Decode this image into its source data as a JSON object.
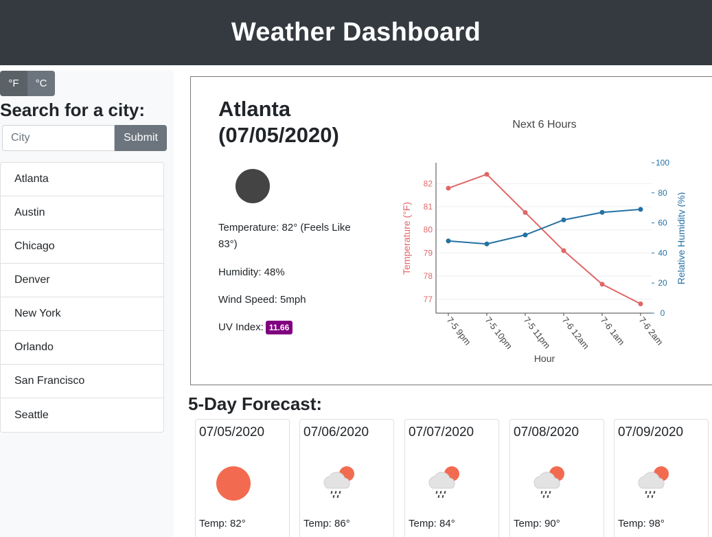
{
  "header": {
    "title": "Weather Dashboard"
  },
  "sidebar": {
    "unit_f": "°F",
    "unit_c": "°C",
    "search_title": "Search for a city:",
    "search_placeholder": "City",
    "submit_label": "Submit",
    "cities": [
      "Atlanta",
      "Austin",
      "Chicago",
      "Denver",
      "New York",
      "Orlando",
      "San Francisco",
      "Seattle"
    ]
  },
  "current": {
    "city": "Atlanta",
    "date": "(07/05/2020)",
    "icon": "moon-icon",
    "temperature_text": "Temperature:  82° (Feels Like 83°)",
    "humidity_text": "Humidity:  48%",
    "wind_text": "Wind Speed:  5mph",
    "uv_label": "UV Index:",
    "uv_value": "11.66",
    "uv_color": "#800080"
  },
  "chart_data": {
    "type": "line",
    "title": "Next 6 Hours",
    "xlabel": "Hour",
    "ylabel": "Temperature (°F)",
    "y2label": "Relative Humidity (%)",
    "categories": [
      "7-5 9pm",
      "7-5 10pm",
      "7-5 11pm",
      "7-6 12am",
      "7-6 1am",
      "7-6 2am"
    ],
    "y_ticks": [
      77,
      78,
      79,
      80,
      81,
      82
    ],
    "y2_ticks": [
      0,
      20,
      40,
      60,
      80,
      100
    ],
    "ylim": [
      76.4,
      82.9
    ],
    "y2lim": [
      0,
      100
    ],
    "series": [
      {
        "axis": "y",
        "color": "#e06666",
        "values": [
          81.8,
          82.4,
          80.75,
          79.1,
          77.65,
          76.8
        ]
      },
      {
        "axis": "y2",
        "color": "#2471a3",
        "values": [
          48,
          46,
          52,
          62,
          67,
          69
        ]
      }
    ]
  },
  "forecast": {
    "title": "5-Day Forecast:",
    "days": [
      {
        "date": "07/05/2020",
        "icon": "sun-icon",
        "temp": "Temp: 82°"
      },
      {
        "date": "07/06/2020",
        "icon": "rain-cloud-icon",
        "temp": "Temp: 86°"
      },
      {
        "date": "07/07/2020",
        "icon": "rain-cloud-icon",
        "temp": "Temp: 84°"
      },
      {
        "date": "07/08/2020",
        "icon": "rain-cloud-icon",
        "temp": "Temp: 90°"
      },
      {
        "date": "07/09/2020",
        "icon": "rain-cloud-icon",
        "temp": "Temp: 98°"
      }
    ],
    "sun_color": "#f26b50"
  }
}
